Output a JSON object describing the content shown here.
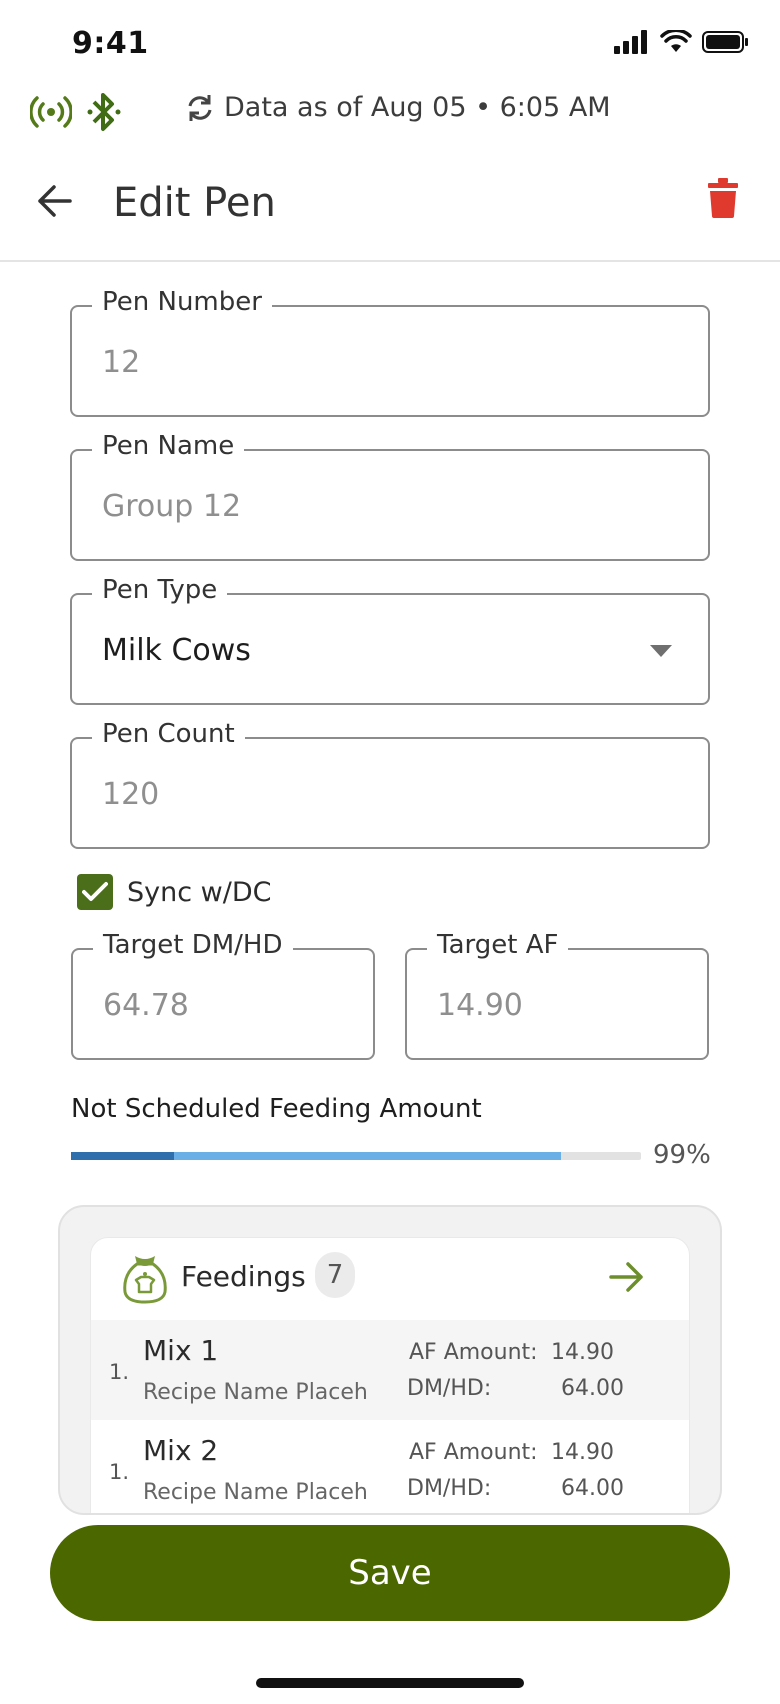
{
  "status_bar": {
    "time": "9:41"
  },
  "connectivity": {
    "sync_text": "Data as of Aug 05 • 6:05 AM"
  },
  "header": {
    "title": "Edit Pen"
  },
  "form": {
    "pen_number": {
      "label": "Pen Number",
      "value": "12"
    },
    "pen_name": {
      "label": "Pen Name",
      "value": "Group 12"
    },
    "pen_type": {
      "label": "Pen Type",
      "value": "Milk Cows"
    },
    "pen_count": {
      "label": "Pen Count",
      "value": "120"
    },
    "sync": {
      "label": "Sync w/DC",
      "checked": true
    },
    "target_dm": {
      "label": "Target DM/HD",
      "value": "64.78"
    },
    "target_af": {
      "label": "Target AF",
      "value": "14.90"
    }
  },
  "feeding_amount": {
    "title": "Not Scheduled Feeding Amount",
    "percent_label": "99%",
    "scheduled_fraction": 0.18,
    "total_fraction": 0.86
  },
  "feedings": {
    "title": "Feedings",
    "count": "7",
    "items": [
      {
        "index": "1.",
        "name": "Mix 1",
        "recipe": "Recipe Name Placeh",
        "af_label": "AF Amount:",
        "af_value": "14.90",
        "dm_label": "DM/HD:",
        "dm_value": "64.00"
      },
      {
        "index": "1.",
        "name": "Mix 2",
        "recipe": "Recipe Name Placeh",
        "af_label": "AF Amount:",
        "af_value": "14.90",
        "dm_label": "DM/HD:",
        "dm_value": "64.00"
      }
    ]
  },
  "actions": {
    "save_label": "Save"
  },
  "colors": {
    "brand_green": "#4b6700",
    "delete_red": "#e03a2f",
    "progress_dark": "#2f6fac",
    "progress_light": "#6ab0e6"
  }
}
